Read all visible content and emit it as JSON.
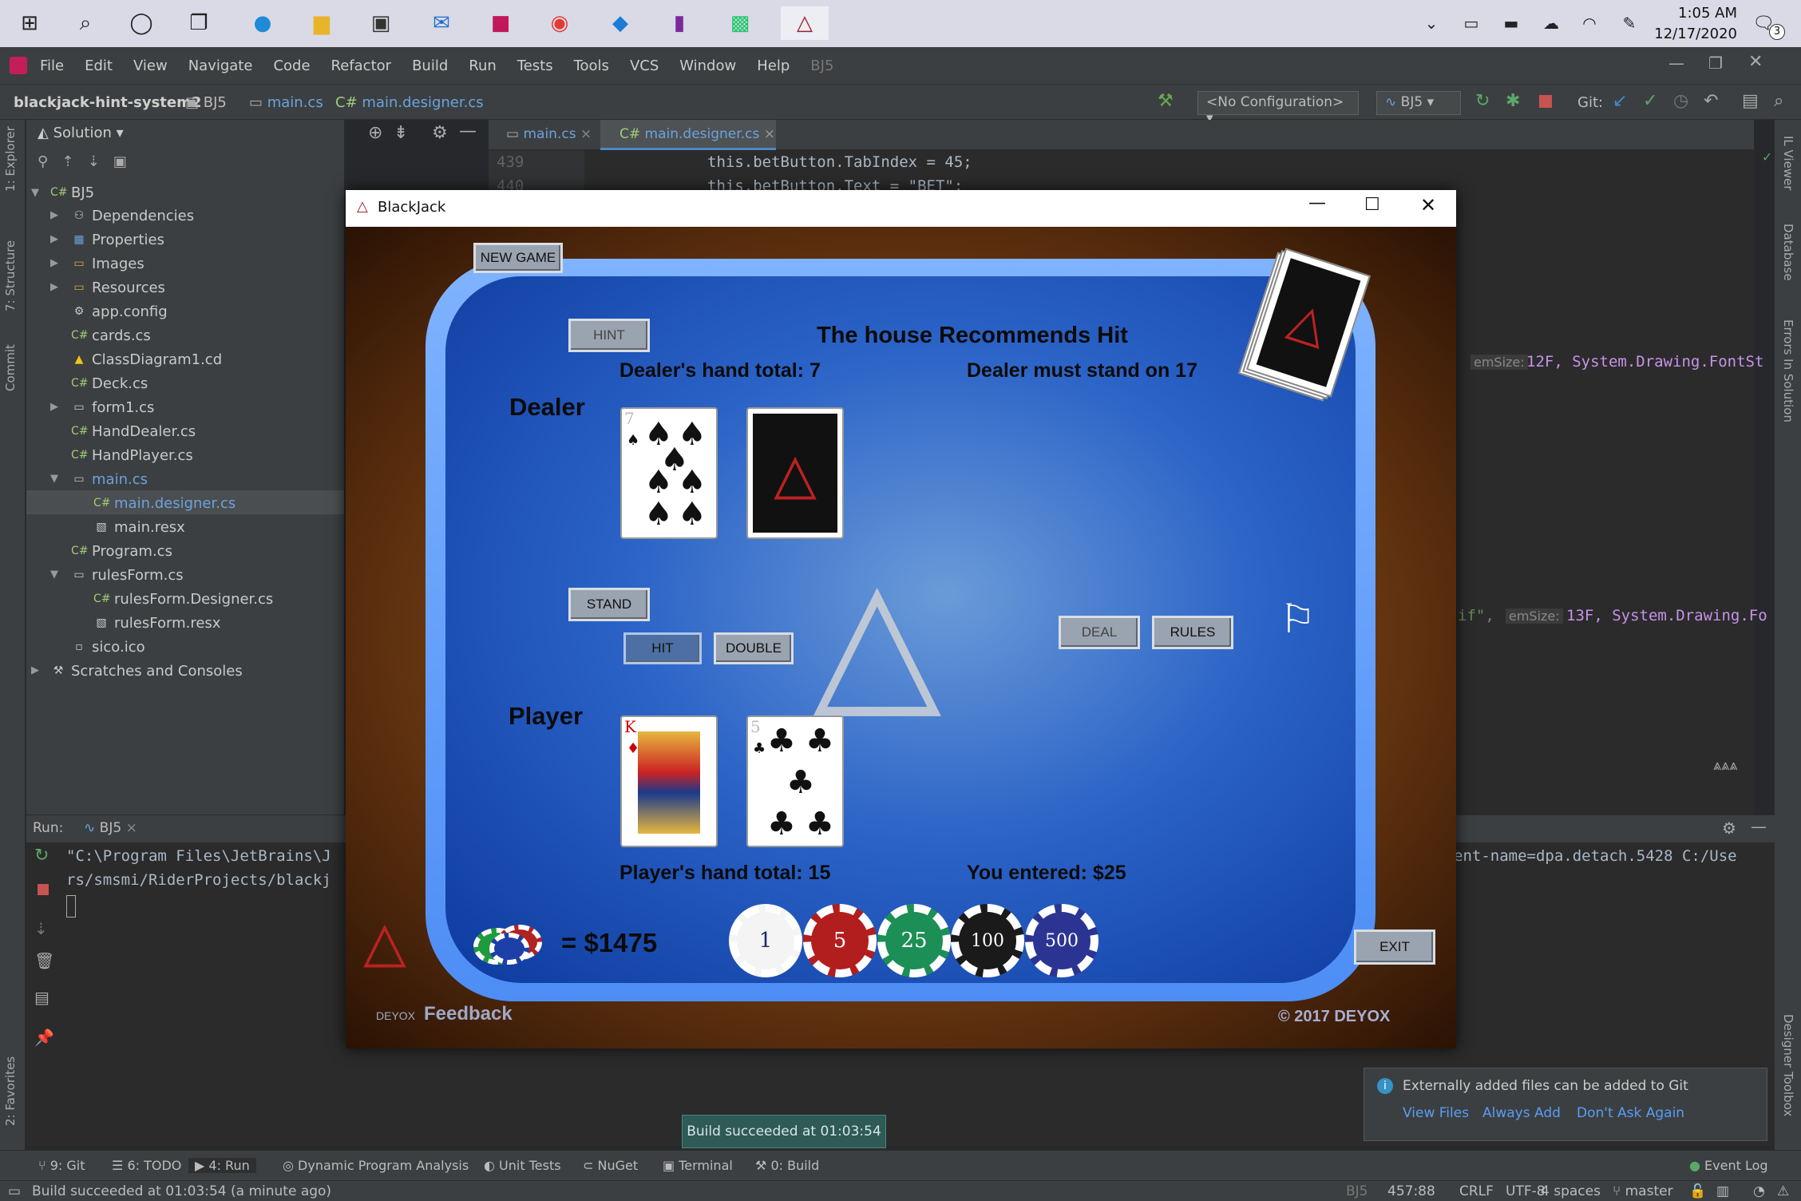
{
  "taskbar": {
    "time": "1:05 AM",
    "date": "12/17/2020",
    "notif_count": "3"
  },
  "menu": [
    "File",
    "Edit",
    "View",
    "Navigate",
    "Code",
    "Refactor",
    "Build",
    "Run",
    "Tests",
    "Tools",
    "VCS",
    "Window",
    "Help",
    "BJ5"
  ],
  "nav": {
    "project": "blackjack-hint-system2",
    "crumb1": "BJ5",
    "crumb2": "main.cs",
    "crumb3": "main.designer.cs",
    "config": "<No Configuration>",
    "run_target": "BJ5",
    "git": "Git:"
  },
  "explorer": {
    "title": "Solution",
    "items": [
      "BJ5",
      "Dependencies",
      "Properties",
      "Images",
      "Resources",
      "app.config",
      "cards.cs",
      "ClassDiagram1.cd",
      "Deck.cs",
      "form1.cs",
      "HandDealer.cs",
      "HandPlayer.cs",
      "main.cs",
      "main.designer.cs",
      "main.resx",
      "Program.cs",
      "rulesForm.cs",
      "rulesForm.Designer.cs",
      "rulesForm.resx",
      "sico.ico",
      "Scratches and Consoles"
    ]
  },
  "left_tabs": [
    "1: Explorer",
    "7: Structure",
    "Commit",
    "2: Favorites"
  ],
  "right_tabs": [
    "IL Viewer",
    "Database",
    "Errors In Solution",
    "Designer Toolbox"
  ],
  "editor": {
    "tab1": "main.cs",
    "tab2": "main.designer.cs",
    "line1_no": "439",
    "line1": "this.betButton.TabIndex = 45;",
    "line2_no": "440",
    "line2": "this.betButton.Text = \"BET\";",
    "hint1_label": "emSize:",
    "hint1": "12F, System.Drawing.FontSt",
    "hint2_pre": "if\",",
    "hint2_label": "emSize:",
    "hint2": "13F, System.Drawing.Fo"
  },
  "run": {
    "label": "Run:",
    "config": "BJ5",
    "line1": "\"C:\\Program Files\\JetBrains\\J",
    "line2": "rs/smsmi/RiderProjects/blackj",
    "line_right": "ent-name=dpa.detach.5428 C:/Use"
  },
  "bottom_tools": [
    "9: Git",
    "6: TODO",
    "4: Run",
    "Dynamic Program Analysis",
    "Unit Tests",
    "NuGet",
    "Terminal",
    "0: Build",
    "Event Log"
  ],
  "status": {
    "message": "Build succeeded at 01:03:54 (a minute ago)",
    "project": "BJ5",
    "position": "457:88",
    "eol": "CRLF",
    "encoding": "UTF-8",
    "indent": "4 spaces",
    "branch": "master"
  },
  "build_popup": "Build succeeded at 01:03:54",
  "notification": {
    "text": "Externally added files can be added to Git",
    "actions": [
      "View Files",
      "Always Add",
      "Don't Ask Again"
    ]
  },
  "game": {
    "window_title": "BlackJack",
    "new_game": "NEW GAME",
    "hint": "HINT",
    "recommend": "The house Recommends Hit",
    "dealer_total": "Dealer's hand total: 7",
    "dealer_rule": "Dealer must stand on 17",
    "dealer": "Dealer",
    "player": "Player",
    "stand": "STAND",
    "hit": "HIT",
    "double": "DOUBLE",
    "deal": "DEAL",
    "rules": "RULES",
    "player_total": "Player's hand total: 15",
    "entered": "You entered: $25",
    "balance": "= $1475",
    "chips": [
      "1",
      "5",
      "25",
      "100",
      "500"
    ],
    "exit": "EXIT",
    "feedback": "Feedback",
    "brand": "DEYOX",
    "copyright": "© 2017 DEYOX",
    "dealer_card_rank": "7",
    "player_card1_rank": "K",
    "player_card2_rank": "5"
  }
}
